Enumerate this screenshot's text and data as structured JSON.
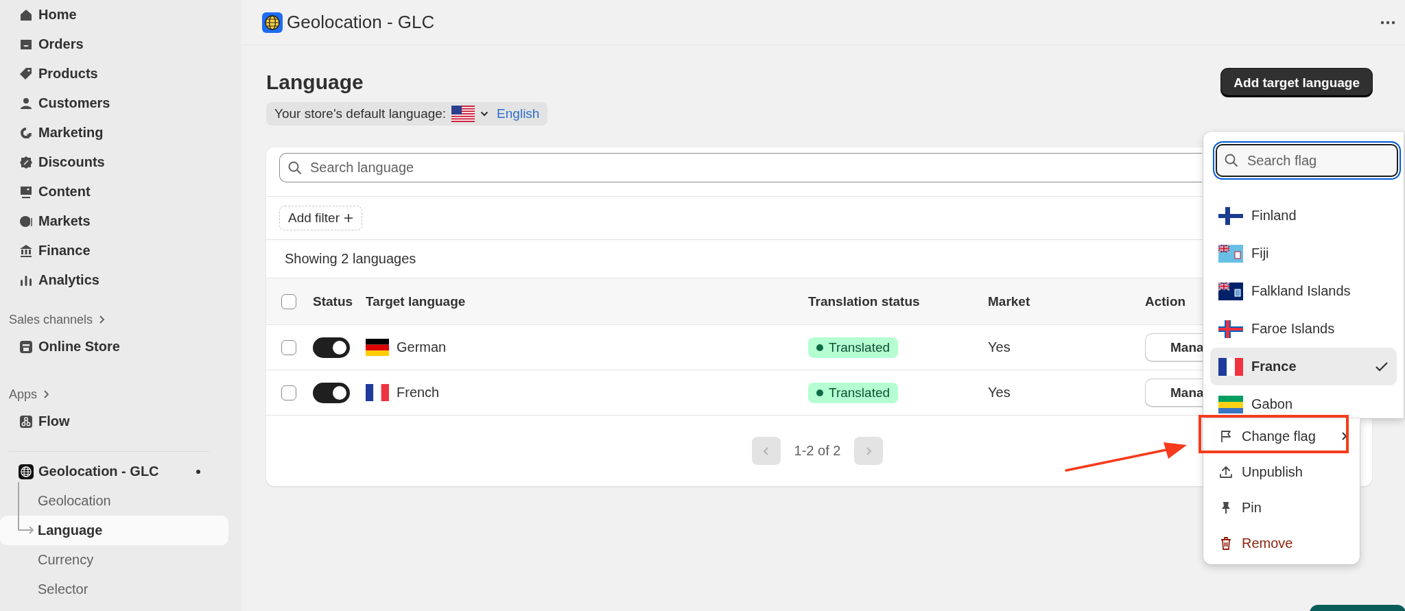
{
  "sidebar": {
    "items": [
      {
        "label": "Home",
        "selected": false
      },
      {
        "label": "Orders",
        "selected": false
      },
      {
        "label": "Products",
        "selected": false
      },
      {
        "label": "Customers",
        "selected": false
      },
      {
        "label": "Marketing",
        "selected": false
      },
      {
        "label": "Discounts",
        "selected": false
      },
      {
        "label": "Content",
        "selected": false
      },
      {
        "label": "Markets",
        "selected": false
      },
      {
        "label": "Finance",
        "selected": false
      },
      {
        "label": "Analytics",
        "selected": false
      }
    ],
    "sections": [
      {
        "title": "Sales channels",
        "items": [
          {
            "label": "Online Store",
            "selected": false
          }
        ]
      },
      {
        "title": "Apps",
        "items": [
          {
            "label": "Flow",
            "selected": false
          }
        ]
      }
    ],
    "app": {
      "name": "Geolocation - GLC",
      "dot": true,
      "children": [
        {
          "label": "Geolocation",
          "selected": false
        },
        {
          "label": "Language",
          "selected": true
        },
        {
          "label": "Currency",
          "selected": false
        },
        {
          "label": "Selector",
          "selected": false
        }
      ]
    }
  },
  "header": {
    "title": "Geolocation - GLC"
  },
  "page": {
    "title": "Language",
    "primary_action": "Add target language",
    "default_language": {
      "label": "Your store's default language:",
      "value": "English"
    }
  },
  "table": {
    "search": {
      "placeholder": "Search language"
    },
    "filter_button": "Add filter",
    "summary": "Showing 2 languages",
    "all_checked": false,
    "columns": [
      "Status",
      "Target language",
      "Translation status",
      "Market",
      "Action"
    ],
    "rows": [
      {
        "checked": false,
        "enabled": true,
        "language": "German",
        "translation_status": "Translated",
        "market": "Yes",
        "action": "Mana"
      },
      {
        "checked": false,
        "enabled": true,
        "language": "French",
        "translation_status": "Translated",
        "market": "Yes",
        "action": "Mana"
      }
    ],
    "pagination": {
      "label": "1-2 of 2",
      "prev_disabled": true,
      "next_disabled": true
    }
  },
  "flag_picker": {
    "search": {
      "placeholder": "Search flag"
    },
    "items": [
      {
        "label": "Finland",
        "selected": false
      },
      {
        "label": "Fiji",
        "selected": false
      },
      {
        "label": "Falkland Islands",
        "selected": false
      },
      {
        "label": "Faroe Islands",
        "selected": false
      },
      {
        "label": "France",
        "selected": true
      },
      {
        "label": "Gabon",
        "selected": false
      }
    ]
  },
  "action_menu": {
    "items": [
      {
        "label": "Change flag",
        "submenu": true,
        "highlighted": true,
        "critical": false
      },
      {
        "label": "Unpublish",
        "submenu": false,
        "highlighted": false,
        "critical": false
      },
      {
        "label": "Pin",
        "submenu": false,
        "highlighted": false,
        "critical": false
      },
      {
        "label": "Remove",
        "submenu": false,
        "highlighted": false,
        "critical": true
      }
    ]
  }
}
